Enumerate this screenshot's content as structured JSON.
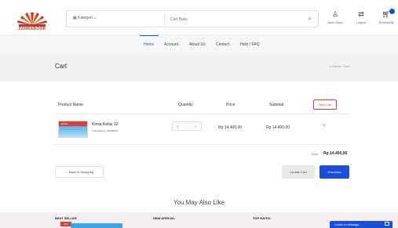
{
  "brand": {
    "logo_text": "ZAHRABOOK"
  },
  "search": {
    "category_label": "Kategori",
    "placeholder": "Cari Buku"
  },
  "header_actions": [
    {
      "label": "Akun Saya"
    },
    {
      "label": "Logout"
    },
    {
      "label": "Keranjang"
    }
  ],
  "nav": [
    "Home",
    "Account",
    "About Us",
    "Contact",
    "Help / FAQ"
  ],
  "page": {
    "title": "Cart",
    "breadcrumb_home": "Home",
    "breadcrumb_sep": "›",
    "breadcrumb_current": "Cart"
  },
  "cart": {
    "columns": [
      "Product Name",
      "Quantity",
      "Price",
      "Subtotal"
    ],
    "view_cart_label": "View Cart",
    "items": [
      {
        "thumb_title": "Kimia",
        "name": "Kimia Kelas 12",
        "code": "Kode Barang: 1BK00001",
        "quantity": "1",
        "price": "Rp 14.400,00",
        "subtotal": "Rp 14.400,00"
      }
    ],
    "total_label": "Total:",
    "total_value": "Rp 14.400,00",
    "back_label": "← Back to Shopping",
    "update_label": "Update Cart",
    "checkout_label": "Checkout"
  },
  "recommend": {
    "heading": "You May Also Like",
    "columns": [
      "BEST SELLER",
      "NEW ARRIVAL",
      "TOP RATED"
    ],
    "sale_tag": "Sale"
  },
  "chat": {
    "label": "Leave a message"
  },
  "colors": {
    "accent": "#1a4fd6",
    "danger": "#e53935",
    "logo": "#c0392b"
  }
}
